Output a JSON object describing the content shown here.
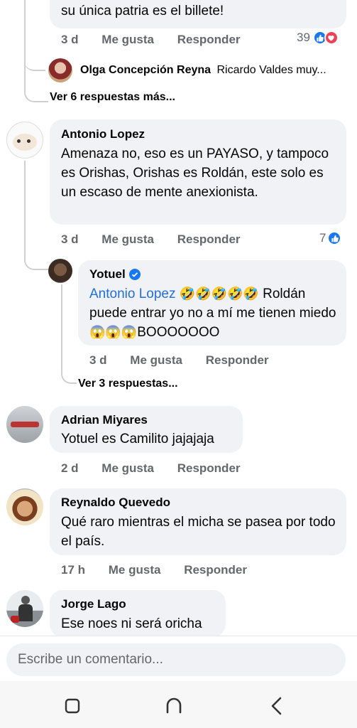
{
  "top_comment": {
    "text": "su única patria es el billete!",
    "time": "3 d",
    "like": "Me gusta",
    "reply": "Responder",
    "reactions": "39"
  },
  "collapsed_reply": {
    "name": "Olga Concepción Reyna",
    "preview": "Ricardo Valdes muy..."
  },
  "more_replies_1": "Ver 6 respuestas más...",
  "comment_antonio": {
    "name": "Antonio Lopez",
    "text": "Amenaza no, eso es un PAYASO, y tampoco es Orishas, Orishas es Roldán, este solo es un escaso de mente anexionista.",
    "time": "3 d",
    "like": "Me gusta",
    "reply": "Responder",
    "reactions": "7"
  },
  "reply_yotuel": {
    "name": "Yotuel",
    "mention": "Antonio Lopez",
    "laugh_emojis": "🤣🤣🤣🤣🤣",
    "text_after": "Roldán puede entrar yo no a mí me tienen miedo",
    "scream_emojis": "😱😱😱",
    "text_end": "BOOOOOOO",
    "time": "3 d",
    "like": "Me gusta",
    "reply": "Responder"
  },
  "more_replies_2": "Ver 3 respuestas...",
  "comment_adrian": {
    "name": "Adrian Miyares",
    "text": "Yotuel es Camilito jajajaja",
    "time": "2 d",
    "like": "Me gusta",
    "reply": "Responder"
  },
  "comment_reynaldo": {
    "name": "Reynaldo Quevedo",
    "text": "Qué raro mientras el micha se pasea por todo el país.",
    "time": "17 h",
    "like": "Me gusta",
    "reply": "Responder"
  },
  "comment_jorge": {
    "name": "Jorge Lago",
    "text": "Ese noes ni será oricha"
  },
  "composer": {
    "placeholder": "Escribe un comentario..."
  },
  "colors": {
    "accent": "#1877f2",
    "mention": "#216fdb",
    "bubble": "#f0f2f5",
    "secondary_text": "#65676b"
  },
  "icons": [
    "like-icon",
    "love-icon",
    "verified-badge-icon",
    "recent-apps-icon",
    "home-icon",
    "back-icon"
  ]
}
